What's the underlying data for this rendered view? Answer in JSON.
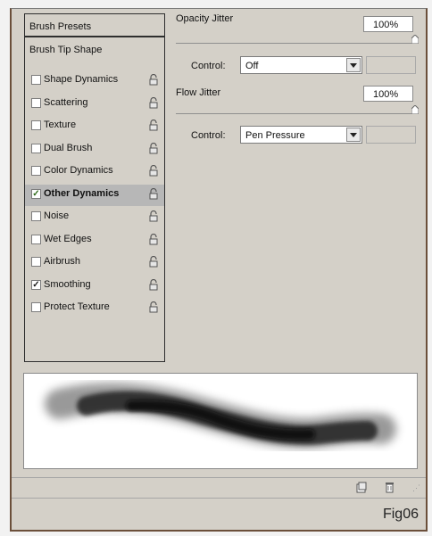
{
  "sidebar": {
    "presets_label": "Brush Presets",
    "tip_shape_label": "Brush Tip Shape",
    "items": [
      {
        "label": "Shape Dynamics",
        "checked": false,
        "selected": false
      },
      {
        "label": "Scattering",
        "checked": false,
        "selected": false
      },
      {
        "label": "Texture",
        "checked": false,
        "selected": false
      },
      {
        "label": "Dual Brush",
        "checked": false,
        "selected": false
      },
      {
        "label": "Color Dynamics",
        "checked": false,
        "selected": false
      },
      {
        "label": "Other Dynamics",
        "checked": true,
        "selected": true
      },
      {
        "label": "Noise",
        "checked": false,
        "selected": false
      },
      {
        "label": "Wet Edges",
        "checked": false,
        "selected": false
      },
      {
        "label": "Airbrush",
        "checked": false,
        "selected": false
      },
      {
        "label": "Smoothing",
        "checked": true,
        "selected": false
      },
      {
        "label": "Protect Texture",
        "checked": false,
        "selected": false
      }
    ]
  },
  "settings": {
    "opacity_jitter": {
      "label": "Opacity Jitter",
      "value": "100%",
      "control_label": "Control:",
      "control_value": "Off"
    },
    "flow_jitter": {
      "label": "Flow Jitter",
      "value": "100%",
      "control_label": "Control:",
      "control_value": "Pen Pressure"
    }
  },
  "icons": {
    "lock": "lock-icon",
    "new_preset": "new-preset-icon",
    "trash": "trash-icon",
    "dropdown": "chevron-down-icon"
  },
  "caption": "Fig06"
}
